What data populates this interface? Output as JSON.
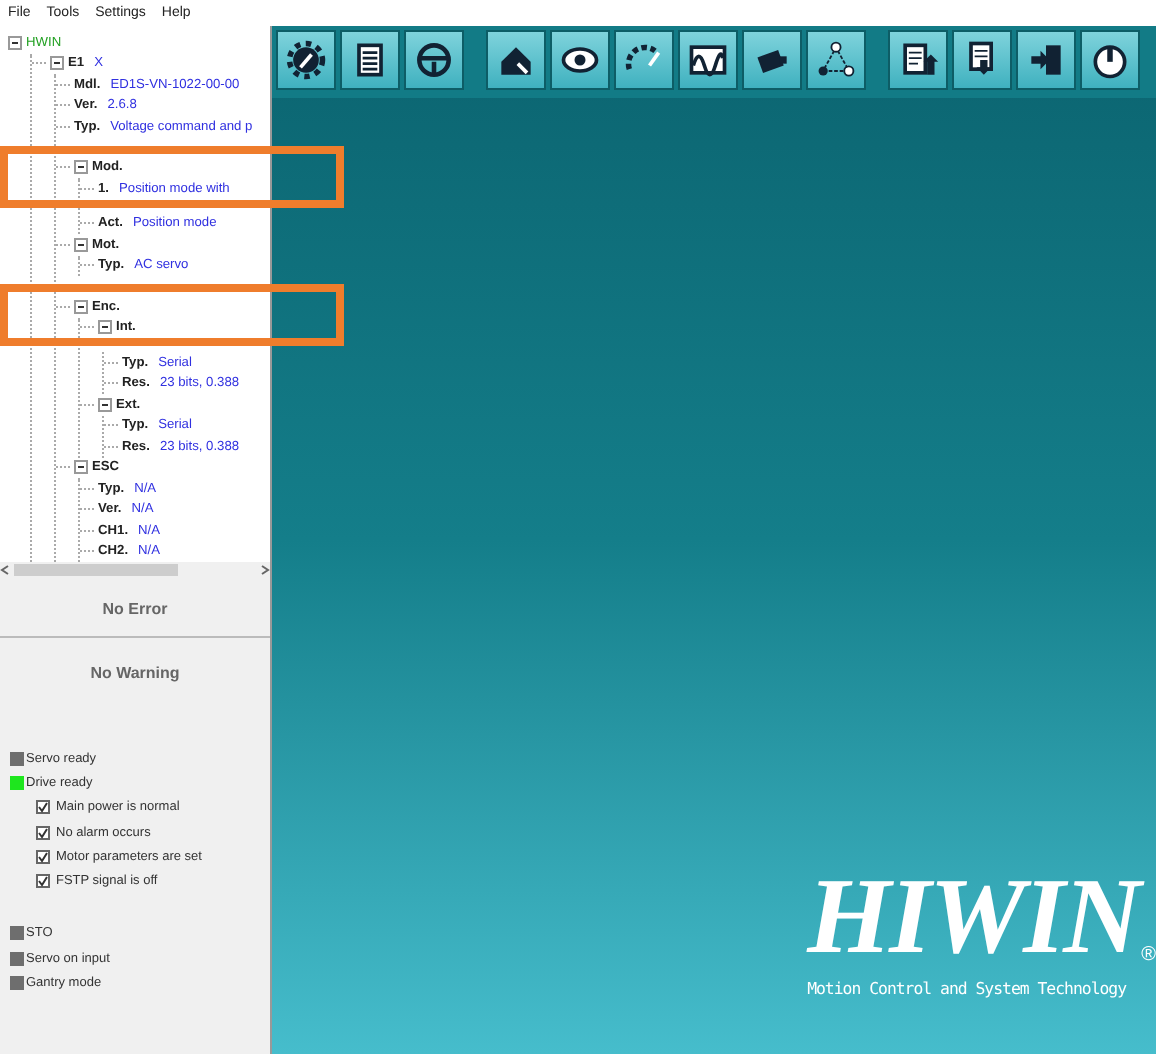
{
  "menu": [
    "File",
    "Tools",
    "Settings",
    "Help"
  ],
  "tree": [
    {
      "label": "HWIN",
      "expanded": true,
      "children": [
        {
          "label": "E1",
          "value": "X",
          "expanded": true,
          "children": [
            {
              "label": "Mdl.",
              "value": "ED1S-VN-1022-00-00"
            },
            {
              "label": "Ver.",
              "value": "2.6.8"
            },
            {
              "label": "Typ.",
              "value": "Voltage command and p"
            },
            {
              "label": "Mod.",
              "expanded": true,
              "highlighted": true,
              "children": [
                {
                  "label": "1.",
                  "value": "Position mode with"
                },
                {
                  "label": "Act.",
                  "value": "Position mode"
                }
              ]
            },
            {
              "label": "Mot.",
              "expanded": true,
              "children": [
                {
                  "label": "Typ.",
                  "value": "AC servo"
                }
              ]
            },
            {
              "label": "Enc.",
              "expanded": true,
              "highlighted": true,
              "children": [
                {
                  "label": "Int.",
                  "expanded": true,
                  "children": [
                    {
                      "label": "Typ.",
                      "value": "Serial"
                    },
                    {
                      "label": "Res.",
                      "value": "23 bits, 0.388"
                    }
                  ]
                },
                {
                  "label": "Ext.",
                  "expanded": true,
                  "children": [
                    {
                      "label": "Typ.",
                      "value": "Serial"
                    },
                    {
                      "label": "Res.",
                      "value": "23 bits, 0.388"
                    }
                  ]
                }
              ]
            },
            {
              "label": "ESC",
              "expanded": true,
              "children": [
                {
                  "label": "Typ.",
                  "value": "N/A"
                },
                {
                  "label": "Ver.",
                  "value": "N/A"
                },
                {
                  "label": "CH1.",
                  "value": "N/A"
                },
                {
                  "label": "CH2.",
                  "value": "N/A"
                }
              ]
            }
          ]
        }
      ]
    }
  ],
  "error_text": "No Error",
  "warning_text": "No Warning",
  "status": [
    {
      "kind": "lamp",
      "label": "Servo ready",
      "color": "#6e6e6e"
    },
    {
      "kind": "lamp",
      "label": "Drive ready",
      "color": "#1ee61e"
    },
    {
      "kind": "check",
      "label": "Main power is normal",
      "checked": true
    },
    {
      "kind": "check",
      "label": "No alarm occurs",
      "checked": true
    },
    {
      "kind": "check",
      "label": "Motor parameters are set",
      "checked": true
    },
    {
      "kind": "check",
      "label": "FSTP signal is off",
      "checked": true
    },
    {
      "kind": "gap"
    },
    {
      "kind": "lamp",
      "label": "STO",
      "color": "#6e6e6e"
    },
    {
      "kind": "lamp",
      "label": "Servo on input",
      "color": "#6e6e6e"
    },
    {
      "kind": "lamp",
      "label": "Gantry mode",
      "color": "#6e6e6e"
    }
  ],
  "toolbar": [
    [
      {
        "kind": "gear"
      },
      {
        "kind": "list"
      },
      {
        "kind": "wheel"
      }
    ],
    [
      {
        "kind": "home"
      },
      {
        "kind": "eye"
      },
      {
        "kind": "gauge"
      },
      {
        "kind": "wave"
      },
      {
        "kind": "motor"
      },
      {
        "kind": "nodes"
      }
    ],
    [
      {
        "kind": "upload"
      },
      {
        "kind": "download"
      },
      {
        "kind": "import"
      },
      {
        "kind": "power"
      }
    ]
  ],
  "logo": {
    "brand": "HIWIN",
    "registered": "®",
    "tagline": "Motion Control and System Technology"
  }
}
